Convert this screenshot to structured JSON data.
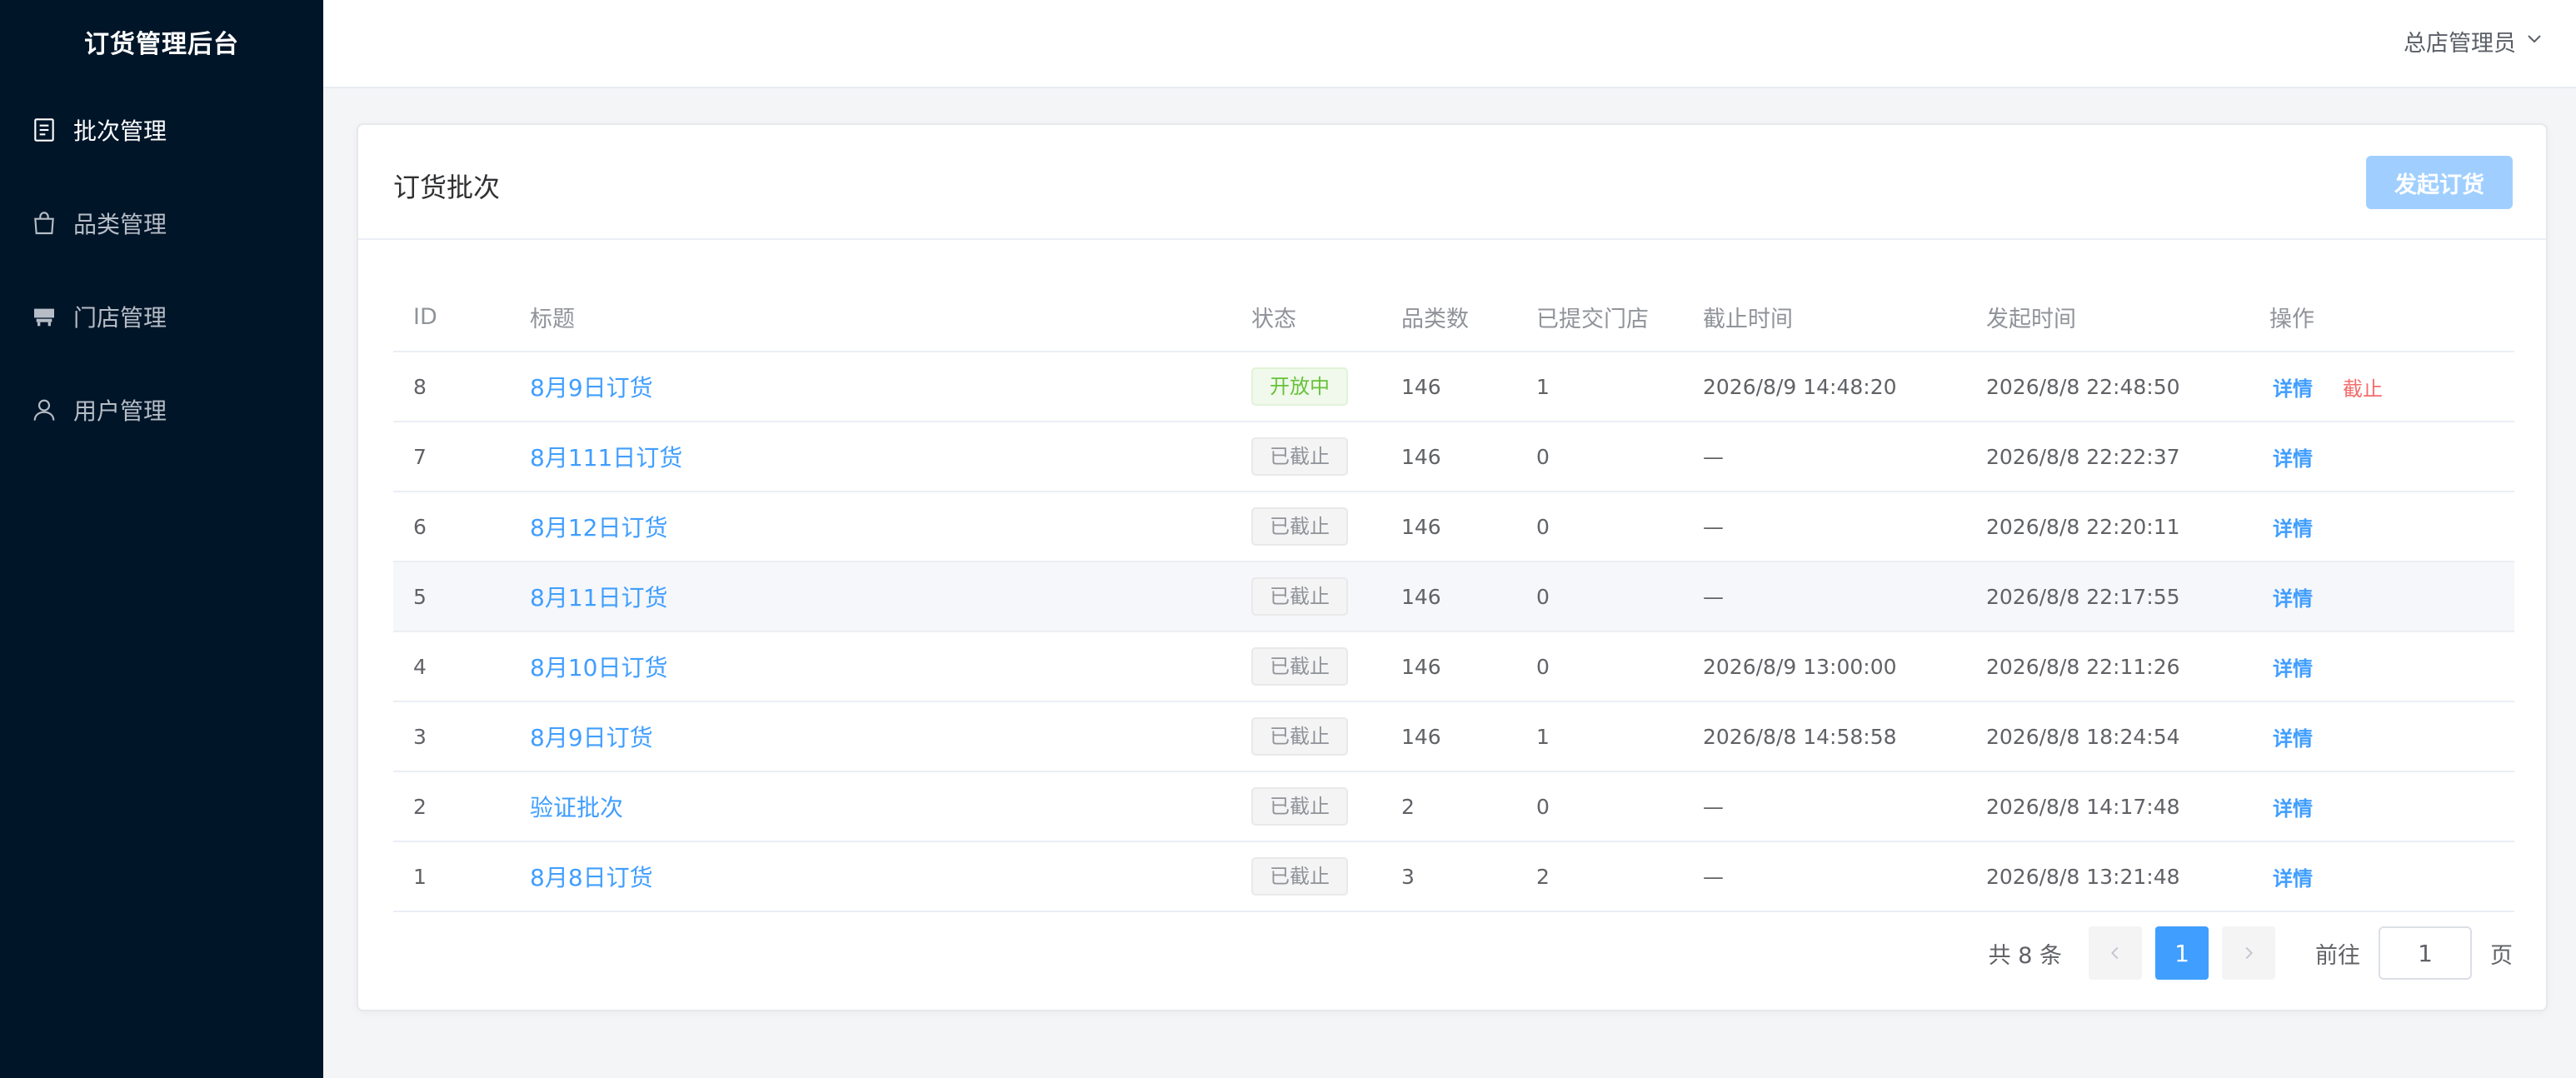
{
  "app": {
    "title": "订货管理后台"
  },
  "sidebar": {
    "items": [
      {
        "label": "批次管理",
        "icon": "document-icon",
        "active": true
      },
      {
        "label": "品类管理",
        "icon": "shopping-bag-icon",
        "active": false
      },
      {
        "label": "门店管理",
        "icon": "store-icon",
        "active": false
      },
      {
        "label": "用户管理",
        "icon": "user-icon",
        "active": false
      }
    ]
  },
  "header": {
    "user": "总店管理员"
  },
  "card": {
    "title": "订货批次",
    "create_button": "发起订货"
  },
  "table": {
    "columns": [
      "ID",
      "标题",
      "状态",
      "品类数",
      "已提交门店",
      "截止时间",
      "发起时间",
      "操作"
    ],
    "rows": [
      {
        "id": "8",
        "title": "8月9日订货",
        "status": "开放中",
        "categories": "146",
        "submitted": "1",
        "deadline": "2026/8/9 14:48:20",
        "created": "2026/8/8 22:48:50",
        "detail": "详情",
        "stop": "截止"
      },
      {
        "id": "7",
        "title": "8月111日订货",
        "status": "已截止",
        "categories": "146",
        "submitted": "0",
        "deadline": "—",
        "created": "2026/8/8 22:22:37",
        "detail": "详情"
      },
      {
        "id": "6",
        "title": "8月12日订货",
        "status": "已截止",
        "categories": "146",
        "submitted": "0",
        "deadline": "—",
        "created": "2026/8/8 22:20:11",
        "detail": "详情"
      },
      {
        "id": "5",
        "title": "8月11日订货",
        "status": "已截止",
        "categories": "146",
        "submitted": "0",
        "deadline": "—",
        "created": "2026/8/8 22:17:55",
        "detail": "详情"
      },
      {
        "id": "4",
        "title": "8月10日订货",
        "status": "已截止",
        "categories": "146",
        "submitted": "0",
        "deadline": "2026/8/9 13:00:00",
        "created": "2026/8/8 22:11:26",
        "detail": "详情"
      },
      {
        "id": "3",
        "title": "8月9日订货",
        "status": "已截止",
        "categories": "146",
        "submitted": "1",
        "deadline": "2026/8/8 14:58:58",
        "created": "2026/8/8 18:24:54",
        "detail": "详情"
      },
      {
        "id": "2",
        "title": "验证批次",
        "status": "已截止",
        "categories": "2",
        "submitted": "0",
        "deadline": "—",
        "created": "2026/8/8 14:17:48",
        "detail": "详情"
      },
      {
        "id": "1",
        "title": "8月8日订货",
        "status": "已截止",
        "categories": "3",
        "submitted": "2",
        "deadline": "—",
        "created": "2026/8/8 13:21:48",
        "detail": "详情"
      }
    ]
  },
  "pagination": {
    "total_text": "共 8 条",
    "current_page": "1",
    "goto_prefix": "前往",
    "goto_value": "1",
    "goto_suffix": "页"
  },
  "colors": {
    "sidebar_bg": "#011529",
    "primary": "#409eff",
    "primary_disabled": "#a0cfff",
    "success": "#67c23a",
    "danger": "#f56c6c"
  }
}
